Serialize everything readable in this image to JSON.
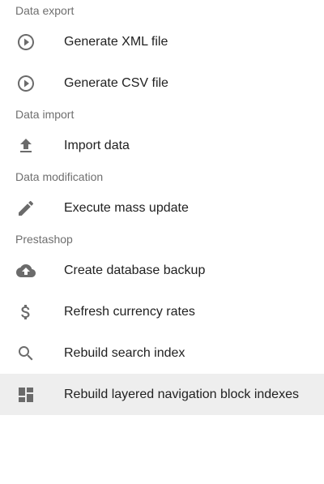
{
  "sections": [
    {
      "header": "Data export",
      "items": [
        {
          "label": "Generate XML file",
          "icon": "play-circle-icon"
        },
        {
          "label": "Generate CSV file",
          "icon": "play-circle-icon"
        }
      ]
    },
    {
      "header": "Data import",
      "items": [
        {
          "label": "Import data",
          "icon": "upload-icon"
        }
      ]
    },
    {
      "header": "Data modification",
      "items": [
        {
          "label": "Execute mass update",
          "icon": "pencil-icon"
        }
      ]
    },
    {
      "header": "Prestashop",
      "items": [
        {
          "label": "Create database backup",
          "icon": "cloud-upload-icon"
        },
        {
          "label": "Refresh currency rates",
          "icon": "dollar-icon"
        },
        {
          "label": "Rebuild search index",
          "icon": "search-icon"
        },
        {
          "label": "Rebuild layered navigation block indexes",
          "icon": "dashboard-icon"
        }
      ]
    }
  ],
  "selected_item": "Rebuild layered navigation block indexes",
  "colors": {
    "header_text": "#6f6f6f",
    "item_text": "#212121",
    "icon": "#6b6b6b",
    "selected_bg": "#eeeeee"
  }
}
